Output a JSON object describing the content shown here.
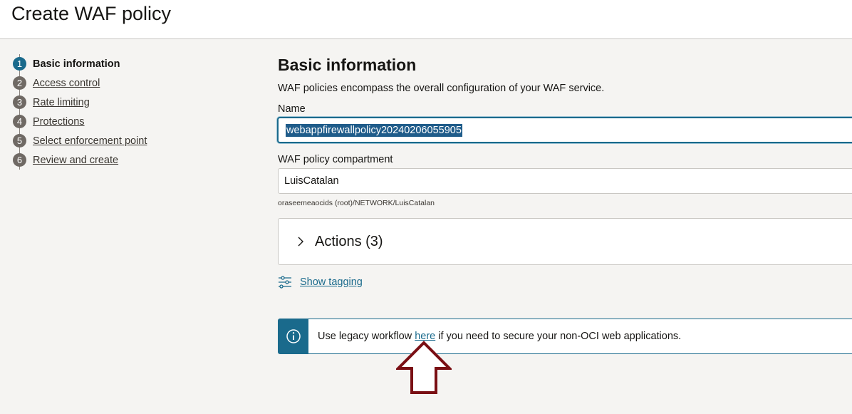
{
  "header": {
    "title": "Create WAF policy"
  },
  "steps": [
    {
      "number": "1",
      "label": "Basic information",
      "active": true
    },
    {
      "number": "2",
      "label": "Access control"
    },
    {
      "number": "3",
      "label": "Rate limiting"
    },
    {
      "number": "4",
      "label": "Protections"
    },
    {
      "number": "5",
      "label": "Select enforcement point"
    },
    {
      "number": "6",
      "label": "Review and create"
    }
  ],
  "main": {
    "title": "Basic information",
    "description": "WAF policies encompass the overall configuration of your WAF service.",
    "name_label": "Name",
    "name_value": "webappfirewallpolicy20240206055905",
    "compartment_label": "WAF policy compartment",
    "compartment_value": "LuisCatalan",
    "compartment_path": "oraseemeaocids (root)/NETWORK/LuisCatalan",
    "actions_title": "Actions (3)",
    "show_tagging": "Show tagging"
  },
  "info_banner": {
    "text_before": "Use legacy workflow ",
    "link": "here",
    "text_after": " if you need to secure your non-OCI web applications."
  },
  "colors": {
    "accent": "#1a6a8c",
    "annotation_arrow": "#7a0f14",
    "background": "#f5f4f2"
  },
  "icons": [
    "chevron-right-icon",
    "tag-sliders-icon",
    "info-icon",
    "up-arrow-annotation"
  ]
}
